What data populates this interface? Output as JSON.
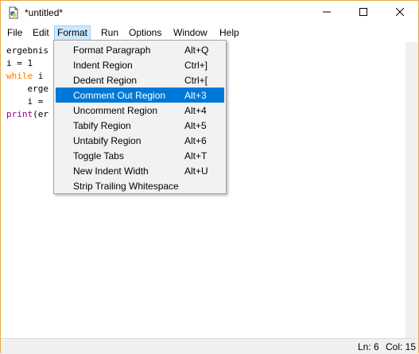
{
  "window": {
    "title": "*untitled*",
    "controls": [
      "minimize",
      "maximize",
      "close"
    ]
  },
  "menubar": {
    "items": [
      "File",
      "Edit",
      "Format",
      "Run",
      "Options",
      "Window",
      "Help"
    ],
    "active": "Format"
  },
  "editor": {
    "lines": [
      {
        "segments": [
          {
            "t": "ergebnis",
            "c": ""
          }
        ]
      },
      {
        "segments": [
          {
            "t": "i = 1",
            "c": ""
          }
        ]
      },
      {
        "segments": [
          {
            "t": "while",
            "c": "kw"
          },
          {
            "t": " i",
            "c": ""
          }
        ]
      },
      {
        "segments": [
          {
            "t": "    erge",
            "c": ""
          }
        ]
      },
      {
        "segments": [
          {
            "t": "    i =",
            "c": ""
          }
        ]
      },
      {
        "segments": [
          {
            "t": "print",
            "c": "bi"
          },
          {
            "t": "(er",
            "c": ""
          }
        ]
      }
    ]
  },
  "format_menu": {
    "items": [
      {
        "label": "Format Paragraph",
        "accel": "Alt+Q"
      },
      {
        "label": "Indent Region",
        "accel": "Ctrl+]"
      },
      {
        "label": "Dedent Region",
        "accel": "Ctrl+["
      },
      {
        "label": "Comment Out Region",
        "accel": "Alt+3",
        "highlighted": true
      },
      {
        "label": "Uncomment Region",
        "accel": "Alt+4"
      },
      {
        "label": "Tabify Region",
        "accel": "Alt+5"
      },
      {
        "label": "Untabify Region",
        "accel": "Alt+6"
      },
      {
        "label": "Toggle Tabs",
        "accel": "Alt+T"
      },
      {
        "label": "New Indent Width",
        "accel": "Alt+U"
      },
      {
        "label": "Strip Trailing Whitespace",
        "accel": ""
      }
    ]
  },
  "status": {
    "line": "Ln: 6",
    "col": "Col: 15"
  },
  "colors": {
    "highlight": "#0078d7",
    "keyword": "#ff7700",
    "builtin": "#900090",
    "active_menu_bg": "#cce8ff"
  },
  "icons": {
    "app": "idle-file-icon",
    "minimize": "minimize-icon",
    "maximize": "maximize-icon",
    "close": "close-icon"
  }
}
